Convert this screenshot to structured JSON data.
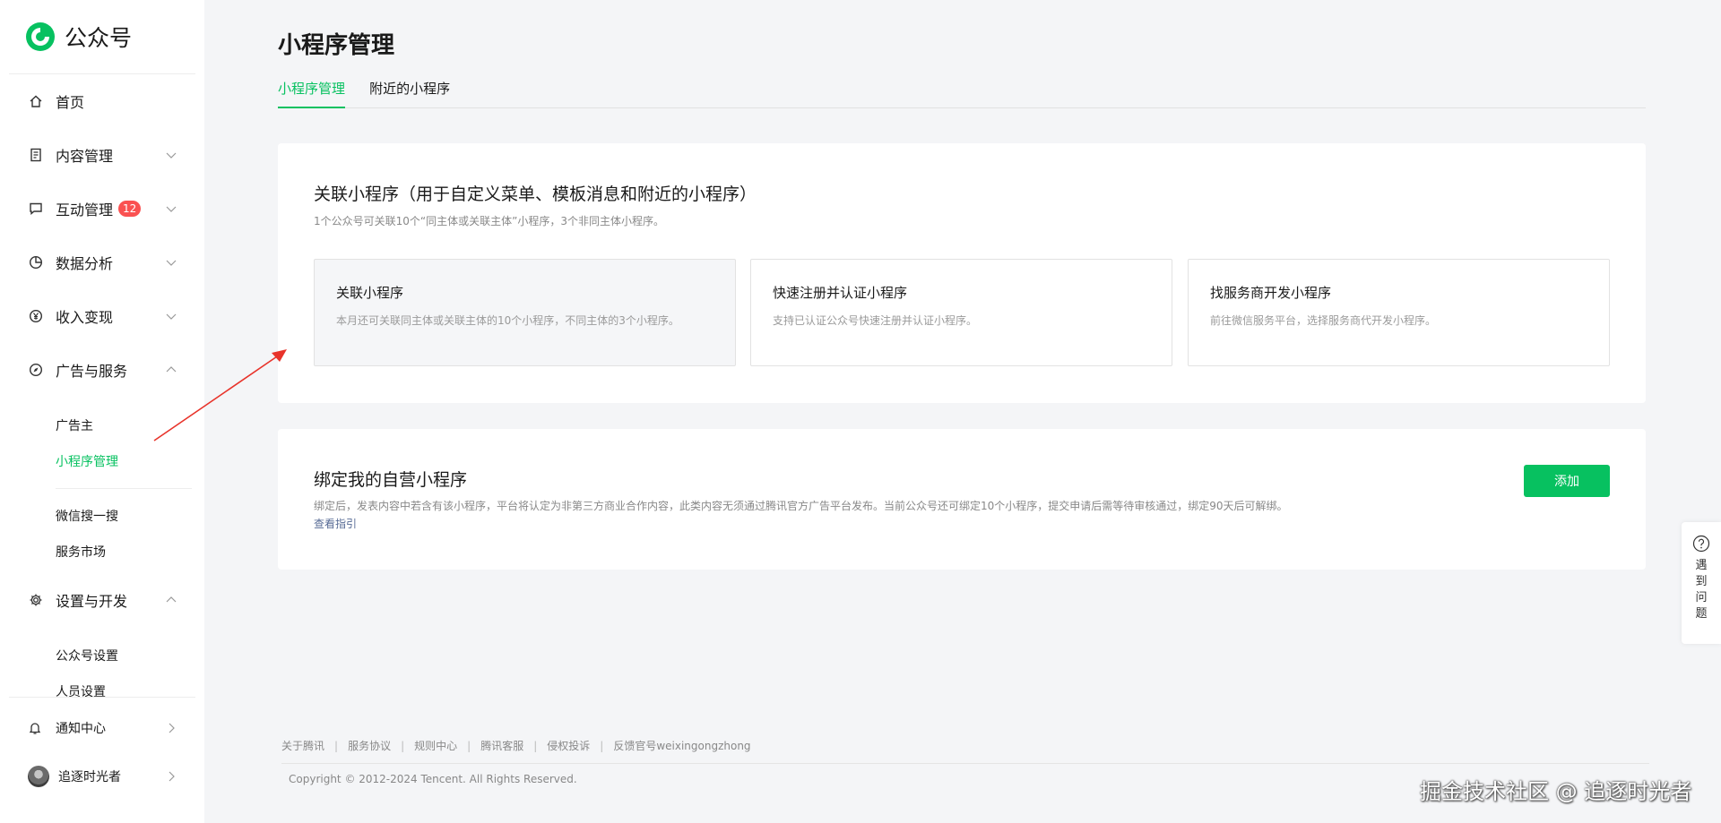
{
  "brand": {
    "name": "公众号"
  },
  "sidebar": {
    "items": [
      {
        "label": "首页",
        "icon": "home-icon"
      },
      {
        "label": "内容管理",
        "icon": "document-icon"
      },
      {
        "label": "互动管理",
        "icon": "chat-icon",
        "badge": "12"
      },
      {
        "label": "数据分析",
        "icon": "pie-chart-icon"
      },
      {
        "label": "收入变现",
        "icon": "yen-icon"
      },
      {
        "label": "广告与服务",
        "icon": "compass-icon"
      }
    ],
    "ads_sub": [
      "广告主",
      "小程序管理"
    ],
    "ads_sub2": [
      "微信搜一搜",
      "服务市场"
    ],
    "settings": {
      "label": "设置与开发",
      "icon": "gear-icon"
    },
    "settings_sub": [
      "公众号设置",
      "人员设置"
    ],
    "notify": "通知中心",
    "user": "追逐时光者"
  },
  "main": {
    "title": "小程序管理",
    "tabs": [
      "小程序管理",
      "附近的小程序"
    ],
    "link_card": {
      "title": "关联小程序（用于自定义菜单、模板消息和附近的小程序）",
      "desc": "1个公众号可关联10个“同主体或关联主体”小程序，3个非同主体小程序。",
      "options": [
        {
          "title": "关联小程序",
          "desc": "本月还可关联同主体或关联主体的10个小程序，不同主体的3个小程序。"
        },
        {
          "title": "快速注册并认证小程序",
          "desc": "支持已认证公众号快速注册并认证小程序。"
        },
        {
          "title": "找服务商开发小程序",
          "desc": "前往微信服务平台，选择服务商代开发小程序。"
        }
      ]
    },
    "bind_card": {
      "title": "绑定我的自营小程序",
      "desc": "绑定后，发表内容中若含有该小程序，平台将认定为非第三方商业合作内容，此类内容无须通过腾讯官方广告平台发布。当前公众号还可绑定10个小程序，提交申请后需等待审核通过，绑定90天后可解绑。",
      "guide_link": "查看指引",
      "add_button": "添加"
    }
  },
  "footer": {
    "links": [
      "关于腾讯",
      "服务协议",
      "规则中心",
      "腾讯客服",
      "侵权投诉",
      "反馈官号weixingongzhong"
    ],
    "copyright": "Copyright © 2012-2024 Tencent. All Rights Reserved."
  },
  "help": {
    "label": "遇到问题"
  },
  "watermark": "掘金技术社区 @ 追逐时光者",
  "colors": {
    "accent": "#07c160",
    "badge": "#fa5151",
    "link": "#576b95",
    "annotation_arrow": "#e8332a"
  }
}
